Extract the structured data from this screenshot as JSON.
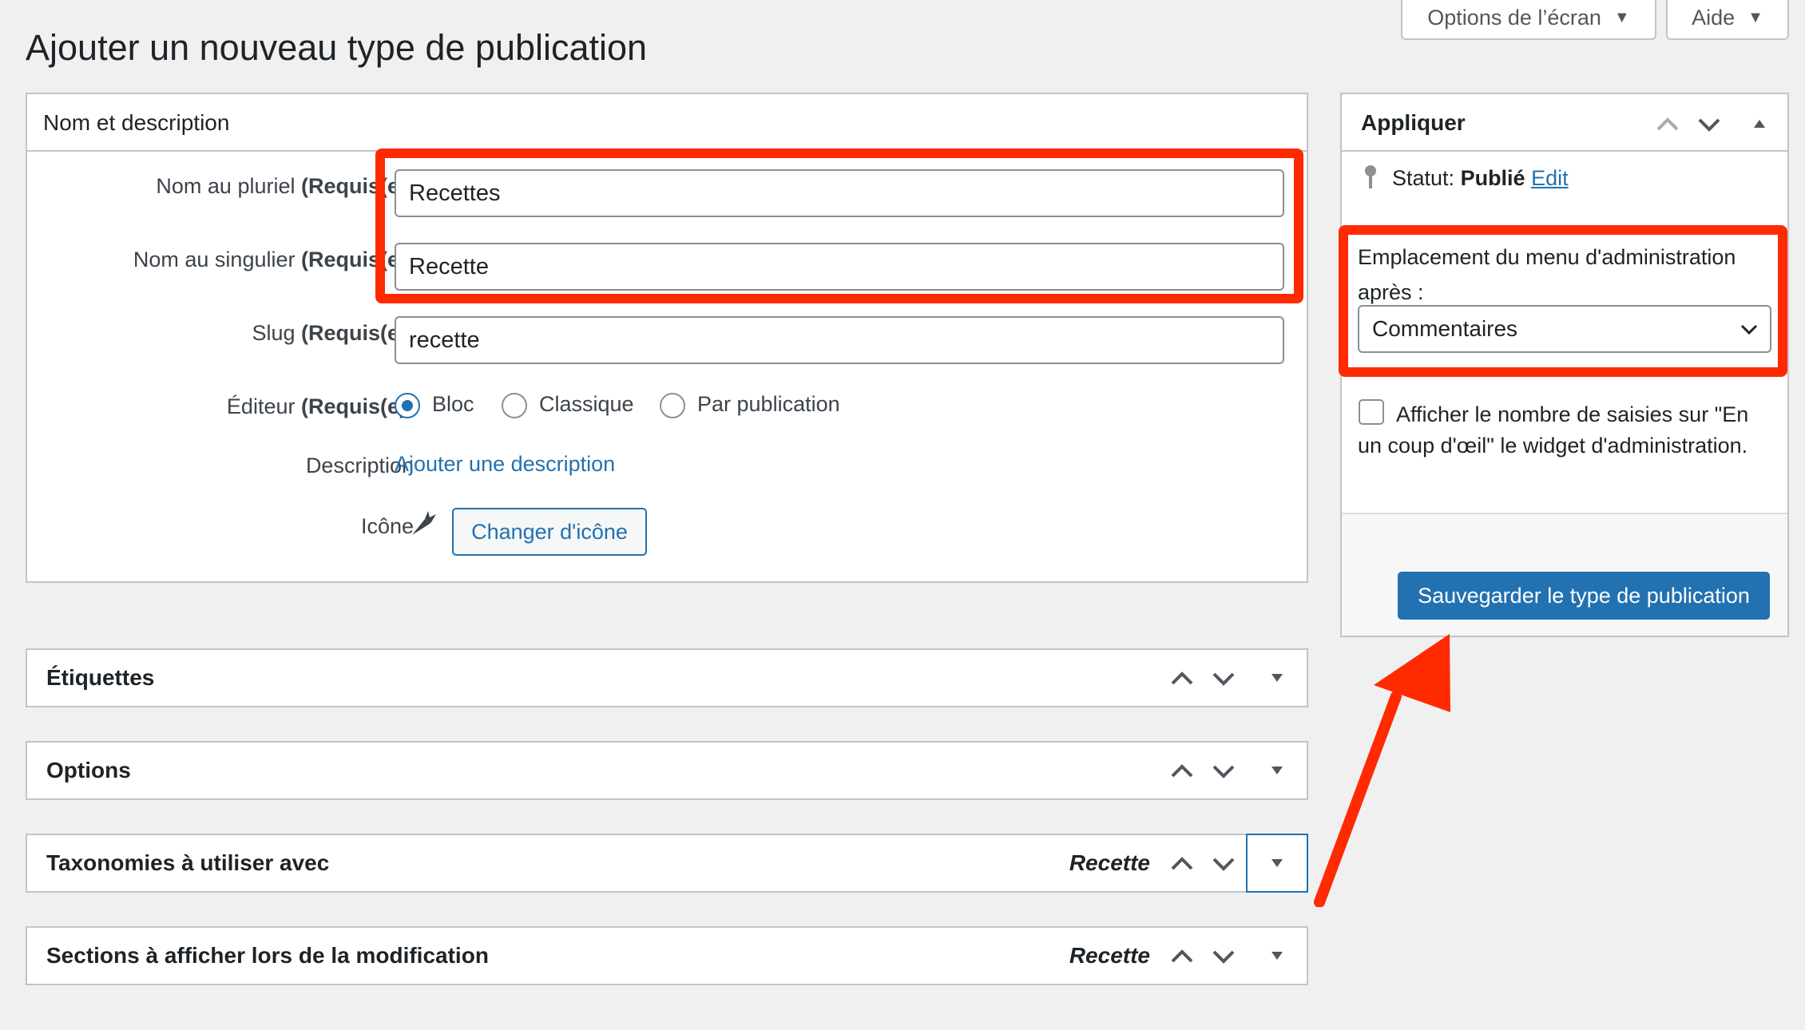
{
  "screen_options": {
    "screen_options_label": "Options de l’écran",
    "help_label": "Aide"
  },
  "page_title": "Ajouter un nouveau type de publication",
  "name_box": {
    "title": "Nom et description",
    "plural": {
      "label": "Nom au pluriel",
      "required": "(Requis(e))",
      "value": "Recettes"
    },
    "singular": {
      "label": "Nom au singulier",
      "required": "(Requis(e))",
      "value": "Recette"
    },
    "slug": {
      "label": "Slug",
      "required": "(Requis(e))",
      "value": "recette"
    },
    "editor": {
      "label": "Éditeur",
      "required": "(Requis(e))",
      "options": [
        "Bloc",
        "Classique",
        "Par publication"
      ],
      "selected": "Bloc"
    },
    "description": {
      "label": "Description",
      "link": "Ajouter une description"
    },
    "icon": {
      "label": "Icône",
      "button": "Changer d'icône",
      "icon_name": "carrot-icon"
    }
  },
  "collapsed_boxes": [
    {
      "title": "Étiquettes",
      "suffix": ""
    },
    {
      "title": "Options",
      "suffix": ""
    },
    {
      "title": "Taxonomies à utiliser avec",
      "suffix": "Recette"
    },
    {
      "title": "Sections à afficher lors de la modification",
      "suffix": "Recette"
    }
  ],
  "publish_box": {
    "title": "Appliquer",
    "status_label": "Statut:",
    "status_value": "Publié",
    "edit_link": "Edit",
    "menu_position_label": "Emplacement du menu d'administration après :",
    "menu_position_value": "Commentaires",
    "glance_checkbox_label": "Afficher le nombre de saisies sur \"En un coup d'œil\" le widget d'administration.",
    "glance_checked": false,
    "save_button": "Sauvegarder le type de publication"
  },
  "colors": {
    "accent": "#2271b1",
    "highlight_red": "#ff2a00",
    "background": "#f0f0f1"
  }
}
